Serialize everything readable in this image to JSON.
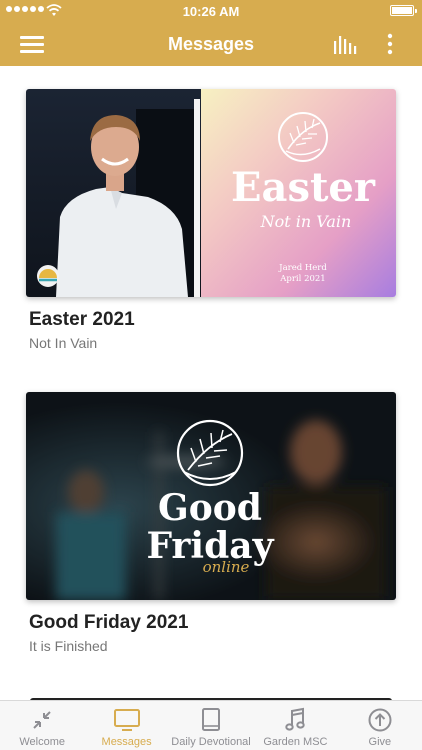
{
  "status_bar": {
    "time": "10:26 AM"
  },
  "header": {
    "title": "Messages"
  },
  "messages": [
    {
      "title": "Easter 2021",
      "subtitle": "Not In Vain",
      "art_title": "Easter",
      "art_tagline": "Not in Vain",
      "art_speaker": "Jared Herd",
      "art_date": "April 2021"
    },
    {
      "title": "Good Friday 2021",
      "subtitle": "It is Finished",
      "art_line1": "Good",
      "art_line2": "Friday",
      "art_tagline": "online"
    }
  ],
  "tabs": [
    {
      "label": "Welcome",
      "icon": "collapse-arrows-icon",
      "active": false
    },
    {
      "label": "Messages",
      "icon": "tv-icon",
      "active": true
    },
    {
      "label": "Daily Devotional",
      "icon": "book-icon",
      "active": false
    },
    {
      "label": "Garden MSC",
      "icon": "music-note-icon",
      "active": false
    },
    {
      "label": "Give",
      "icon": "upload-circle-icon",
      "active": false
    }
  ],
  "colors": {
    "accent": "#d7ac4f",
    "inactive": "#8e8e93"
  }
}
